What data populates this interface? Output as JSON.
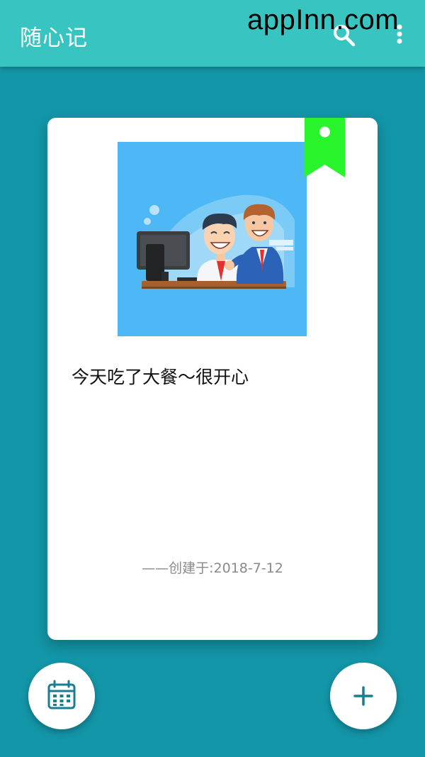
{
  "app_bar": {
    "title": "随心记",
    "watermark": "appInn.com",
    "icons": [
      "search-icon",
      "more-vert-icon"
    ]
  },
  "note_card": {
    "bookmark_color": "#27f42b",
    "image_alt": "two-men-at-computer-illustration",
    "text": "今天吃了大餐～很开心",
    "created_label": "——创建于:2018-7-12"
  },
  "fabs": {
    "left_icon": "calendar-icon",
    "right_icon": "add-icon"
  },
  "colors": {
    "background": "#1396a8",
    "app_bar": "#38c4c0",
    "accent": "#1a7e92"
  }
}
